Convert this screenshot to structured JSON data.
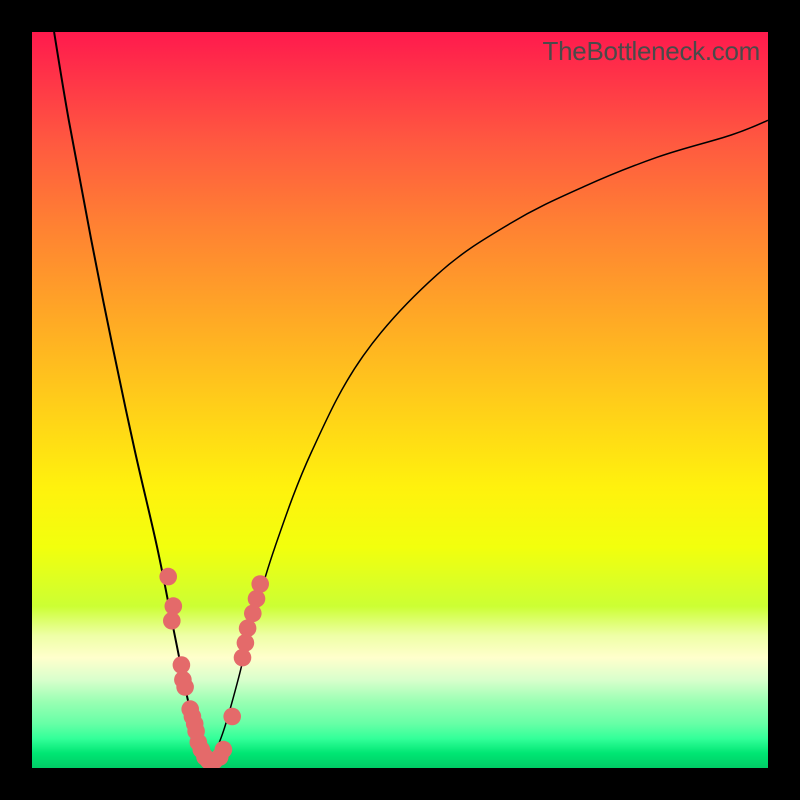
{
  "watermark_text": "TheBottleneck.com",
  "colors": {
    "frame": "#000000",
    "curve": "#000000",
    "dots": "#e46a6a"
  },
  "chart_data": {
    "type": "line",
    "title": "",
    "xlabel": "",
    "ylabel": "",
    "xlim": [
      0,
      100
    ],
    "ylim": [
      0,
      100
    ],
    "grid": false,
    "legend": false,
    "annotations": [
      "TheBottleneck.com"
    ],
    "v_apex_x_percent": 24,
    "series": [
      {
        "name": "left-curve",
        "x": [
          3,
          5,
          8,
          11,
          14,
          17,
          19,
          20,
          21,
          22,
          23,
          24
        ],
        "y": [
          100,
          88,
          72,
          57,
          43,
          30,
          20,
          15,
          10,
          6,
          3,
          0
        ]
      },
      {
        "name": "right-curve",
        "x": [
          24,
          26,
          28,
          30,
          33,
          38,
          45,
          55,
          65,
          75,
          85,
          95,
          100
        ],
        "y": [
          0,
          5,
          12,
          20,
          30,
          43,
          56,
          67,
          74,
          79,
          83,
          86,
          88
        ]
      }
    ],
    "dots": [
      {
        "x": 18.5,
        "y": 26
      },
      {
        "x": 19.2,
        "y": 22
      },
      {
        "x": 19.0,
        "y": 20
      },
      {
        "x": 20.3,
        "y": 14
      },
      {
        "x": 20.5,
        "y": 12
      },
      {
        "x": 20.8,
        "y": 11
      },
      {
        "x": 21.5,
        "y": 8
      },
      {
        "x": 21.8,
        "y": 7
      },
      {
        "x": 22.1,
        "y": 6
      },
      {
        "x": 22.3,
        "y": 5
      },
      {
        "x": 22.6,
        "y": 3.5
      },
      {
        "x": 23.0,
        "y": 2.5
      },
      {
        "x": 23.5,
        "y": 1.5
      },
      {
        "x": 24.0,
        "y": 1
      },
      {
        "x": 24.8,
        "y": 1
      },
      {
        "x": 25.5,
        "y": 1.5
      },
      {
        "x": 26.0,
        "y": 2.5
      },
      {
        "x": 27.2,
        "y": 7
      },
      {
        "x": 28.6,
        "y": 15
      },
      {
        "x": 29.0,
        "y": 17
      },
      {
        "x": 29.3,
        "y": 19
      },
      {
        "x": 30.0,
        "y": 21
      },
      {
        "x": 30.5,
        "y": 23
      },
      {
        "x": 31.0,
        "y": 25
      }
    ],
    "dot_radius_percent": 1.2
  }
}
